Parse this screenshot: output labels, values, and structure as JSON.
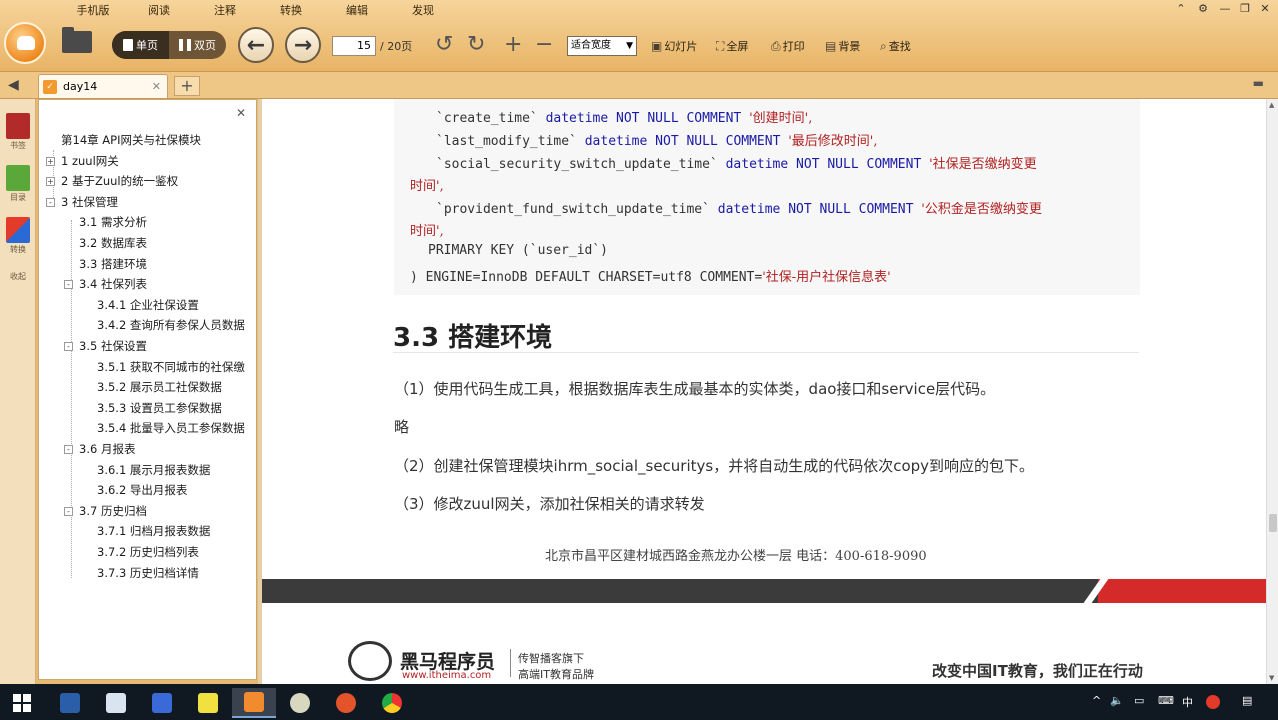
{
  "menu": [
    "手机版",
    "阅读",
    "注释",
    "转换",
    "编辑",
    "发现"
  ],
  "toolbar": {
    "single_page": "单页",
    "double_page": "双页",
    "current_page": "15",
    "total_pages": "/ 20页",
    "zoom": "适合宽度",
    "slideshow": "幻灯片",
    "fullscreen": "全屏",
    "print": "打印",
    "background": "背景",
    "find": "查找"
  },
  "tab": {
    "label": "day14"
  },
  "leftstrip": [
    "书签",
    "目录",
    "转换",
    "收起"
  ],
  "outline": [
    {
      "label": "第14章 API网关与社保模块",
      "level": 0
    },
    {
      "label": "1 zuul网关",
      "level": 1,
      "exp": "+"
    },
    {
      "label": "2 基于Zuul的统一鉴权",
      "level": 1,
      "exp": "+"
    },
    {
      "label": "3 社保管理",
      "level": 1,
      "exp": "-"
    },
    {
      "label": "3.1 需求分析",
      "level": 2
    },
    {
      "label": "3.2 数据库表",
      "level": 2
    },
    {
      "label": "3.3 搭建环境",
      "level": 2
    },
    {
      "label": "3.4 社保列表",
      "level": 2,
      "exp": "-"
    },
    {
      "label": "3.4.1 企业社保设置",
      "level": 3
    },
    {
      "label": "3.4.2 查询所有参保人员数据",
      "level": 3
    },
    {
      "label": "3.5 社保设置",
      "level": 2,
      "exp": "-"
    },
    {
      "label": "3.5.1 获取不同城市的社保缴",
      "level": 3
    },
    {
      "label": "3.5.2 展示员工社保数据",
      "level": 3
    },
    {
      "label": "3.5.3 设置员工参保数据",
      "level": 3
    },
    {
      "label": "3.5.4 批量导入员工参保数据",
      "level": 3
    },
    {
      "label": "3.6 月报表",
      "level": 2,
      "exp": "-"
    },
    {
      "label": "3.6.1 展示月报表数据",
      "level": 3
    },
    {
      "label": "3.6.2 导出月报表",
      "level": 3
    },
    {
      "label": "3.7 历史归档",
      "level": 2,
      "exp": "-"
    },
    {
      "label": "3.7.1 归档月报表数据",
      "level": 3
    },
    {
      "label": "3.7.2 历史归档列表",
      "level": 3
    },
    {
      "label": "3.7.3 历史归档详情",
      "level": 3
    }
  ],
  "code": {
    "l1_field": "`create_time`",
    "l1_type": "datetime",
    "l1_nn": "NOT NULL COMMENT",
    "l1_str": "'创建时间',",
    "l2_field": "`last_modify_time`",
    "l2_type": "datetime",
    "l2_nn": "NOT NULL COMMENT",
    "l2_str": "'最后修改时间',",
    "l3_field": "`social_security_switch_update_time`",
    "l3_type": "datetime",
    "l3_nn": "NOT NULL COMMENT",
    "l3_str": "'社保是否缴纳变更",
    "l3_cont": "时间',",
    "l4_field": "`provident_fund_switch_update_time`",
    "l4_type": "datetime",
    "l4_nn": "NOT NULL COMMENT",
    "l4_str": "'公积金是否缴纳变更",
    "l4_cont": "时间',",
    "l5": "PRIMARY KEY (`user_id`)",
    "l6": ") ENGINE=InnoDB DEFAULT CHARSET=utf8 COMMENT=",
    "l6_str": "'社保-用户社保信息表'"
  },
  "heading": "3.3 搭建环境",
  "paragraphs": [
    "（1）使用代码生成工具，根据数据库表生成最基本的实体类，dao接口和service层代码。",
    "略",
    "（2）创建社保管理模块ihrm_social_securitys，并将自动生成的代码依次copy到响应的包下。",
    "（3）修改zuul网关，添加社保相关的请求转发"
  ],
  "footer": {
    "address": "北京市昌平区建材城西路金燕龙办公楼一层    电话：400-618-9090",
    "brand_name": "黑马程序员",
    "brand_url": "www.itheima.com",
    "tag1": "传智播客旗下",
    "tag2": "高端IT教育品牌",
    "slogan": "改变中国IT教育，我们正在行动"
  },
  "tray": {
    "ime": "中"
  }
}
